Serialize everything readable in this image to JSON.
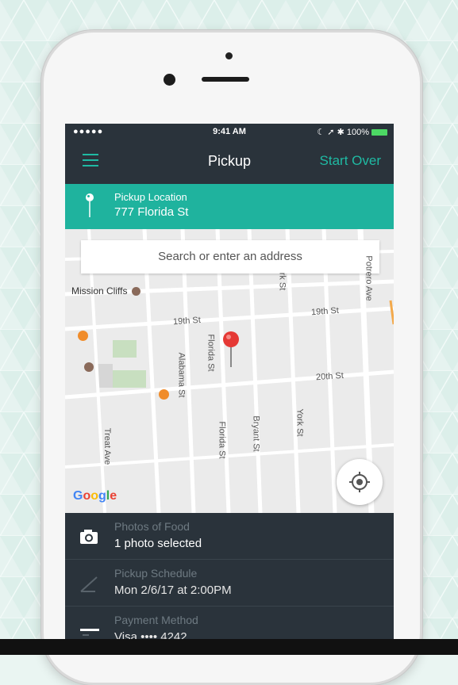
{
  "status_bar": {
    "signal": "●●●●● ",
    "time": "9:41 AM",
    "right": "☾ ➚ ✱ 100%"
  },
  "nav": {
    "menu_icon": "hamburger-icon",
    "title": "Pickup",
    "start_over": "Start Over"
  },
  "pickup": {
    "label": "Pickup Location",
    "value": "777 Florida St",
    "icon": "map-pin-icon"
  },
  "map": {
    "search_placeholder": "Search or enter an address",
    "poi": "Mission Cliffs",
    "streets": {
      "nineteenth_a": "19th St",
      "nineteenth_b": "19th St",
      "twentieth": "20th St",
      "florida_a": "Florida St",
      "florida_b": "Florida St",
      "alabama": "Alabama St",
      "bryant": "Bryant St",
      "york_a": "York St",
      "york_b": "rk St",
      "treat": "Treat Ave",
      "potrero": "Potrero Ave"
    },
    "logo": "Google"
  },
  "rows": [
    {
      "label": "Photos of Food",
      "value": "1 photo selected",
      "icon": "camera-icon"
    },
    {
      "label": "Pickup Schedule",
      "value": "Mon 2/6/17 at 2:00PM",
      "icon": "pencil-icon"
    },
    {
      "label": "Payment Method",
      "value": "Visa  •••• 4242",
      "icon": "credit-card-icon"
    }
  ],
  "colors": {
    "accent": "#1fb39e",
    "dark": "#2a333b",
    "pin": "#e53935"
  }
}
